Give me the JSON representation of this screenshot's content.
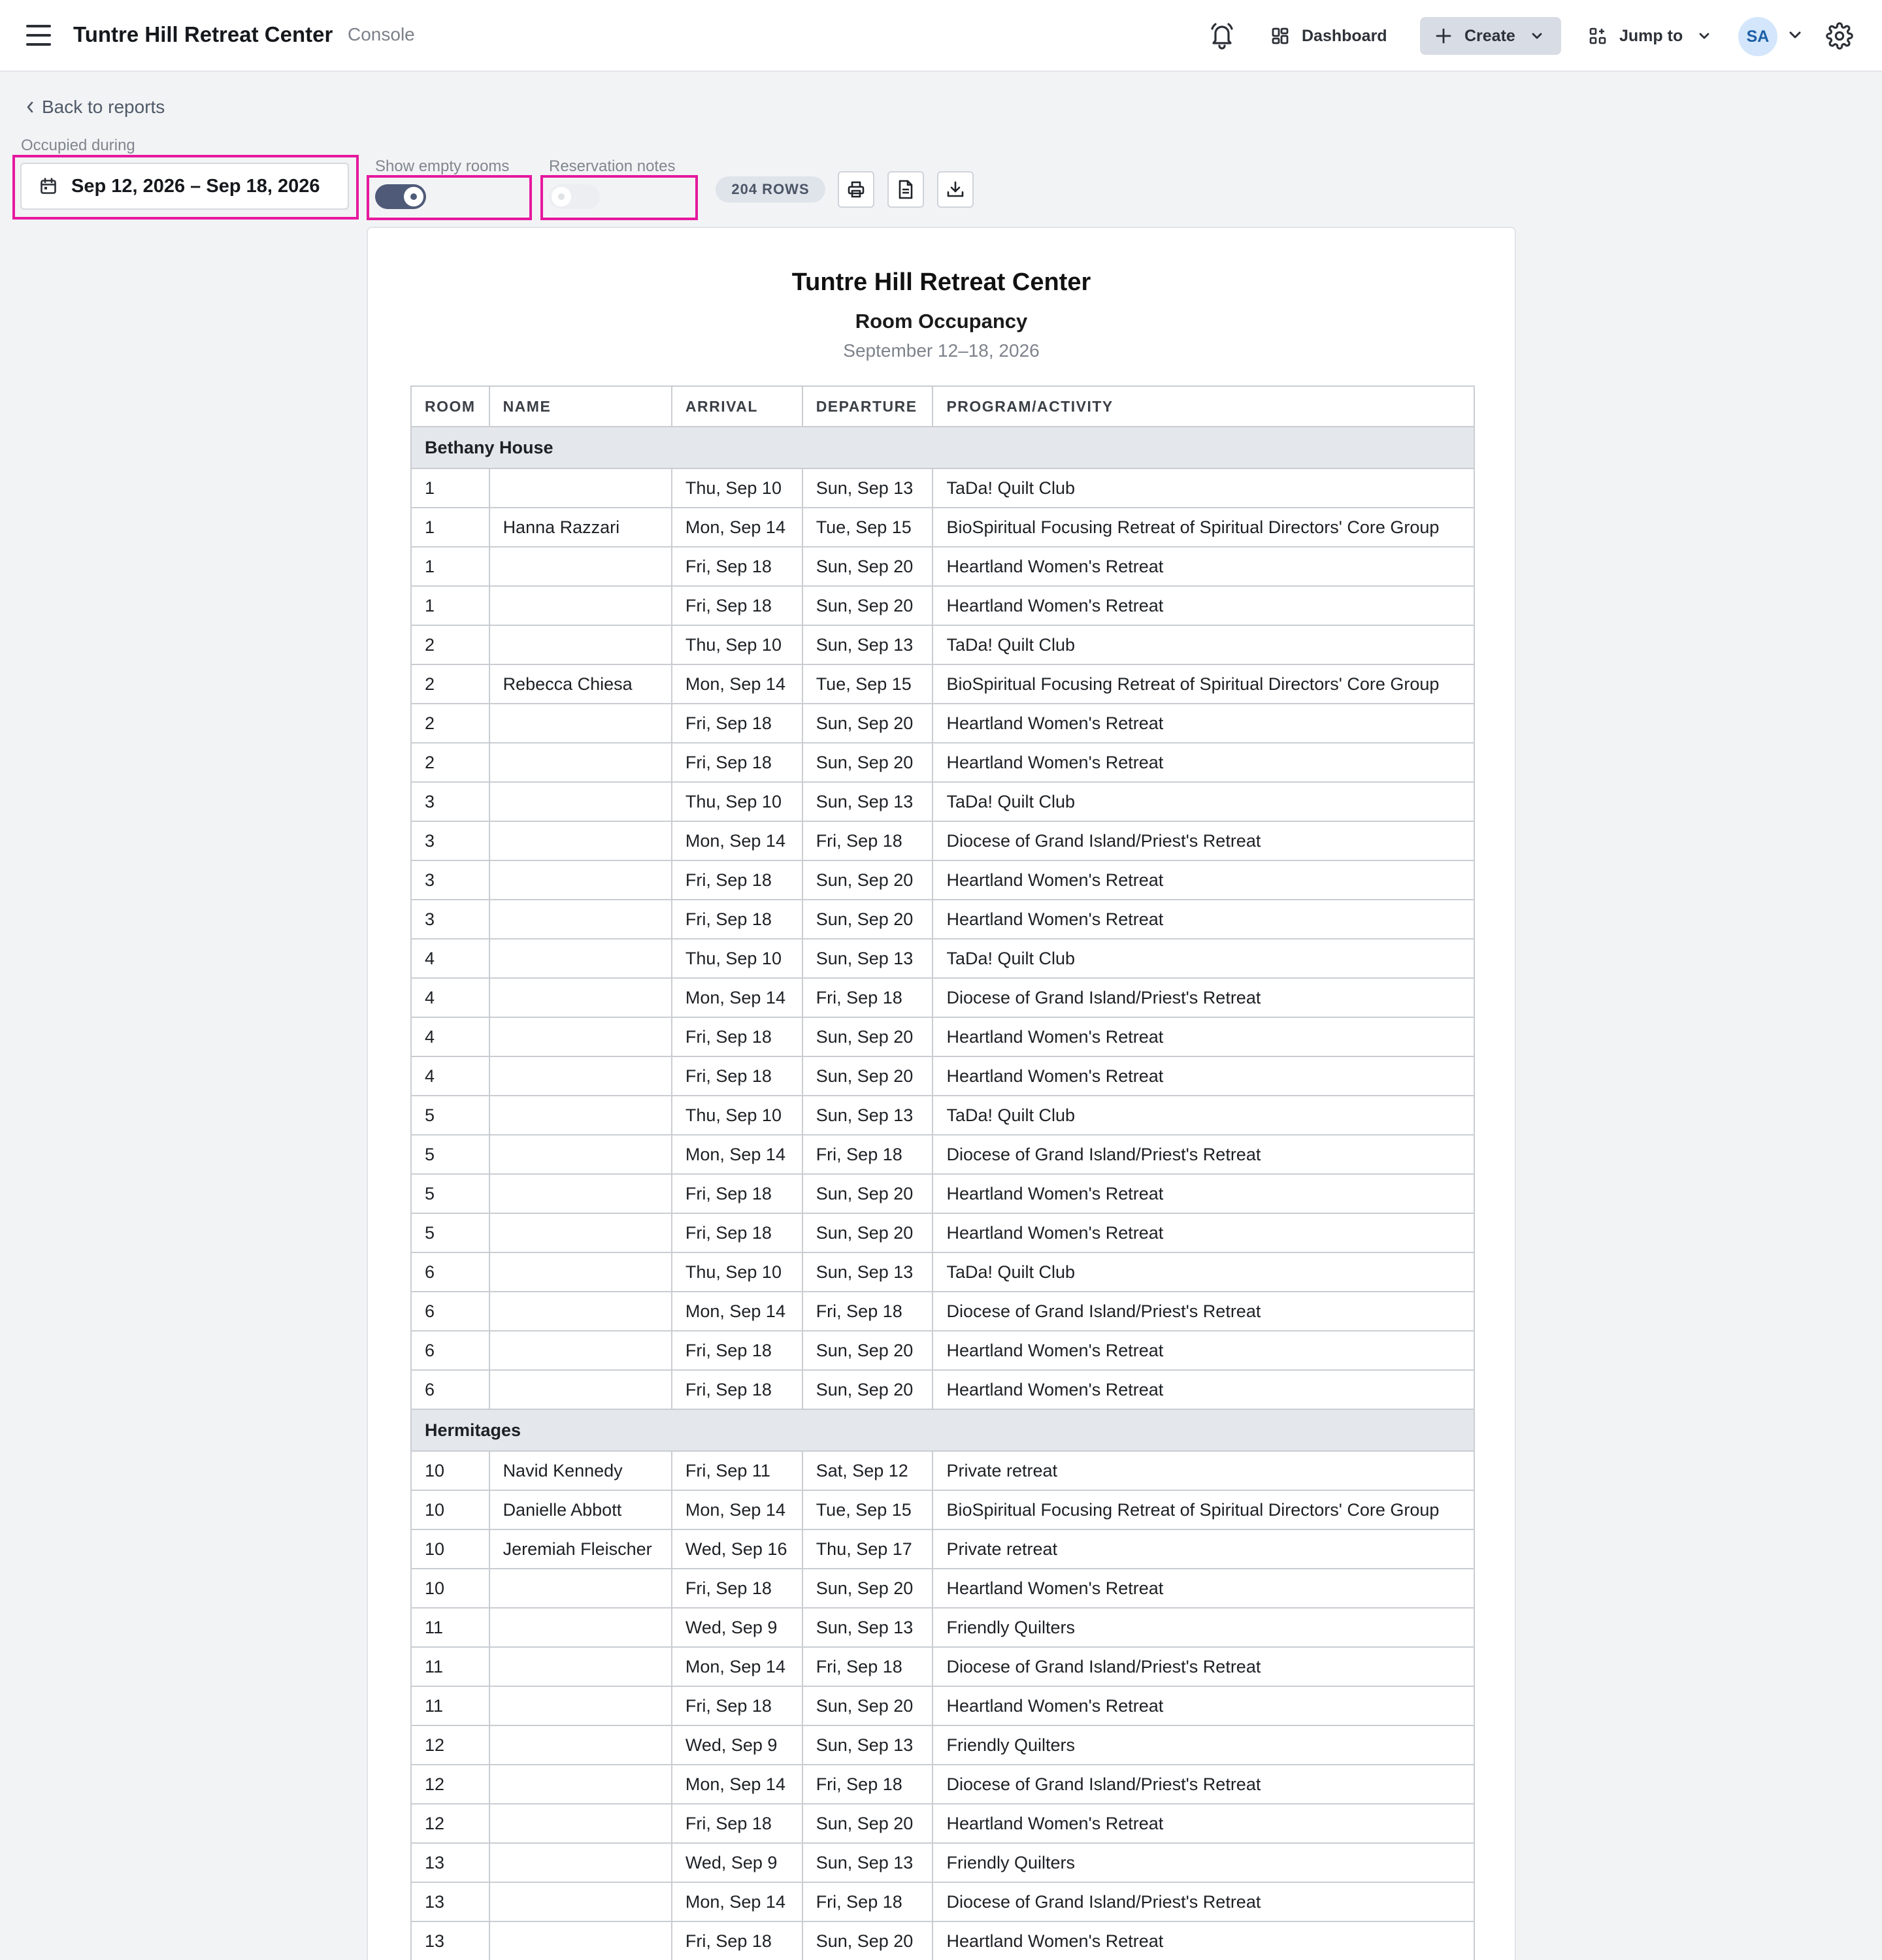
{
  "header": {
    "app_title": "Tuntre Hill Retreat Center",
    "app_subtitle": "Console",
    "dashboard_label": "Dashboard",
    "create_label": "Create",
    "jump_label": "Jump to",
    "avatar_initials": "SA"
  },
  "nav": {
    "back_label": "Back to reports"
  },
  "filters": {
    "occupied_label": "Occupied during",
    "date_range": "Sep 12, 2026 – Sep 18, 2026",
    "show_empty_label": "Show empty rooms",
    "show_empty_on": true,
    "notes_label": "Reservation notes",
    "notes_on": false,
    "rows_badge": "204 ROWS"
  },
  "report": {
    "title": "Tuntre Hill Retreat Center",
    "subtitle": "Room Occupancy",
    "date_line": "September 12–18, 2026",
    "columns": [
      "ROOM",
      "NAME",
      "ARRIVAL",
      "DEPARTURE",
      "PROGRAM/ACTIVITY"
    ],
    "groups": [
      {
        "name": "Bethany House",
        "rows": [
          [
            "1",
            "",
            "Thu, Sep 10",
            "Sun, Sep 13",
            "TaDa! Quilt Club"
          ],
          [
            "1",
            "Hanna Razzari",
            "Mon, Sep 14",
            "Tue, Sep 15",
            "BioSpiritual Focusing Retreat of Spiritual Directors' Core Group"
          ],
          [
            "1",
            "",
            "Fri, Sep 18",
            "Sun, Sep 20",
            "Heartland Women's Retreat"
          ],
          [
            "1",
            "",
            "Fri, Sep 18",
            "Sun, Sep 20",
            "Heartland Women's Retreat"
          ],
          [
            "2",
            "",
            "Thu, Sep 10",
            "Sun, Sep 13",
            "TaDa! Quilt Club"
          ],
          [
            "2",
            "Rebecca Chiesa",
            "Mon, Sep 14",
            "Tue, Sep 15",
            "BioSpiritual Focusing Retreat of Spiritual Directors' Core Group"
          ],
          [
            "2",
            "",
            "Fri, Sep 18",
            "Sun, Sep 20",
            "Heartland Women's Retreat"
          ],
          [
            "2",
            "",
            "Fri, Sep 18",
            "Sun, Sep 20",
            "Heartland Women's Retreat"
          ],
          [
            "3",
            "",
            "Thu, Sep 10",
            "Sun, Sep 13",
            "TaDa! Quilt Club"
          ],
          [
            "3",
            "",
            "Mon, Sep 14",
            "Fri, Sep 18",
            "Diocese of Grand Island/Priest's Retreat"
          ],
          [
            "3",
            "",
            "Fri, Sep 18",
            "Sun, Sep 20",
            "Heartland Women's Retreat"
          ],
          [
            "3",
            "",
            "Fri, Sep 18",
            "Sun, Sep 20",
            "Heartland Women's Retreat"
          ],
          [
            "4",
            "",
            "Thu, Sep 10",
            "Sun, Sep 13",
            "TaDa! Quilt Club"
          ],
          [
            "4",
            "",
            "Mon, Sep 14",
            "Fri, Sep 18",
            "Diocese of Grand Island/Priest's Retreat"
          ],
          [
            "4",
            "",
            "Fri, Sep 18",
            "Sun, Sep 20",
            "Heartland Women's Retreat"
          ],
          [
            "4",
            "",
            "Fri, Sep 18",
            "Sun, Sep 20",
            "Heartland Women's Retreat"
          ],
          [
            "5",
            "",
            "Thu, Sep 10",
            "Sun, Sep 13",
            "TaDa! Quilt Club"
          ],
          [
            "5",
            "",
            "Mon, Sep 14",
            "Fri, Sep 18",
            "Diocese of Grand Island/Priest's Retreat"
          ],
          [
            "5",
            "",
            "Fri, Sep 18",
            "Sun, Sep 20",
            "Heartland Women's Retreat"
          ],
          [
            "5",
            "",
            "Fri, Sep 18",
            "Sun, Sep 20",
            "Heartland Women's Retreat"
          ],
          [
            "6",
            "",
            "Thu, Sep 10",
            "Sun, Sep 13",
            "TaDa! Quilt Club"
          ],
          [
            "6",
            "",
            "Mon, Sep 14",
            "Fri, Sep 18",
            "Diocese of Grand Island/Priest's Retreat"
          ],
          [
            "6",
            "",
            "Fri, Sep 18",
            "Sun, Sep 20",
            "Heartland Women's Retreat"
          ],
          [
            "6",
            "",
            "Fri, Sep 18",
            "Sun, Sep 20",
            "Heartland Women's Retreat"
          ]
        ]
      },
      {
        "name": "Hermitages",
        "rows": [
          [
            "10",
            "Navid Kennedy",
            "Fri, Sep 11",
            "Sat, Sep 12",
            "Private retreat"
          ],
          [
            "10",
            "Danielle Abbott",
            "Mon, Sep 14",
            "Tue, Sep 15",
            "BioSpiritual Focusing Retreat of Spiritual Directors' Core Group"
          ],
          [
            "10",
            "Jeremiah Fleischer",
            "Wed, Sep 16",
            "Thu, Sep 17",
            "Private retreat"
          ],
          [
            "10",
            "",
            "Fri, Sep 18",
            "Sun, Sep 20",
            "Heartland Women's Retreat"
          ],
          [
            "11",
            "",
            "Wed, Sep 9",
            "Sun, Sep 13",
            "Friendly Quilters"
          ],
          [
            "11",
            "",
            "Mon, Sep 14",
            "Fri, Sep 18",
            "Diocese of Grand Island/Priest's Retreat"
          ],
          [
            "11",
            "",
            "Fri, Sep 18",
            "Sun, Sep 20",
            "Heartland Women's Retreat"
          ],
          [
            "12",
            "",
            "Wed, Sep 9",
            "Sun, Sep 13",
            "Friendly Quilters"
          ],
          [
            "12",
            "",
            "Mon, Sep 14",
            "Fri, Sep 18",
            "Diocese of Grand Island/Priest's Retreat"
          ],
          [
            "12",
            "",
            "Fri, Sep 18",
            "Sun, Sep 20",
            "Heartland Women's Retreat"
          ],
          [
            "13",
            "",
            "Wed, Sep 9",
            "Sun, Sep 13",
            "Friendly Quilters"
          ],
          [
            "13",
            "",
            "Mon, Sep 14",
            "Fri, Sep 18",
            "Diocese of Grand Island/Priest's Retreat"
          ],
          [
            "13",
            "",
            "Fri, Sep 18",
            "Sun, Sep 20",
            "Heartland Women's Retreat"
          ]
        ]
      }
    ]
  },
  "icons": {
    "menu": "menu-icon",
    "bell": "bell-icon",
    "dashboard": "dashboard-icon",
    "create": "plus-icon",
    "jump": "jump-icon",
    "settings": "gear-icon",
    "calendar": "calendar-icon",
    "print": "printer-icon",
    "document": "document-icon",
    "download": "download-icon"
  },
  "colors": {
    "highlight": "#e6189e",
    "toggle_on": "#4e5a78",
    "group_row": "#e4e7eb"
  }
}
